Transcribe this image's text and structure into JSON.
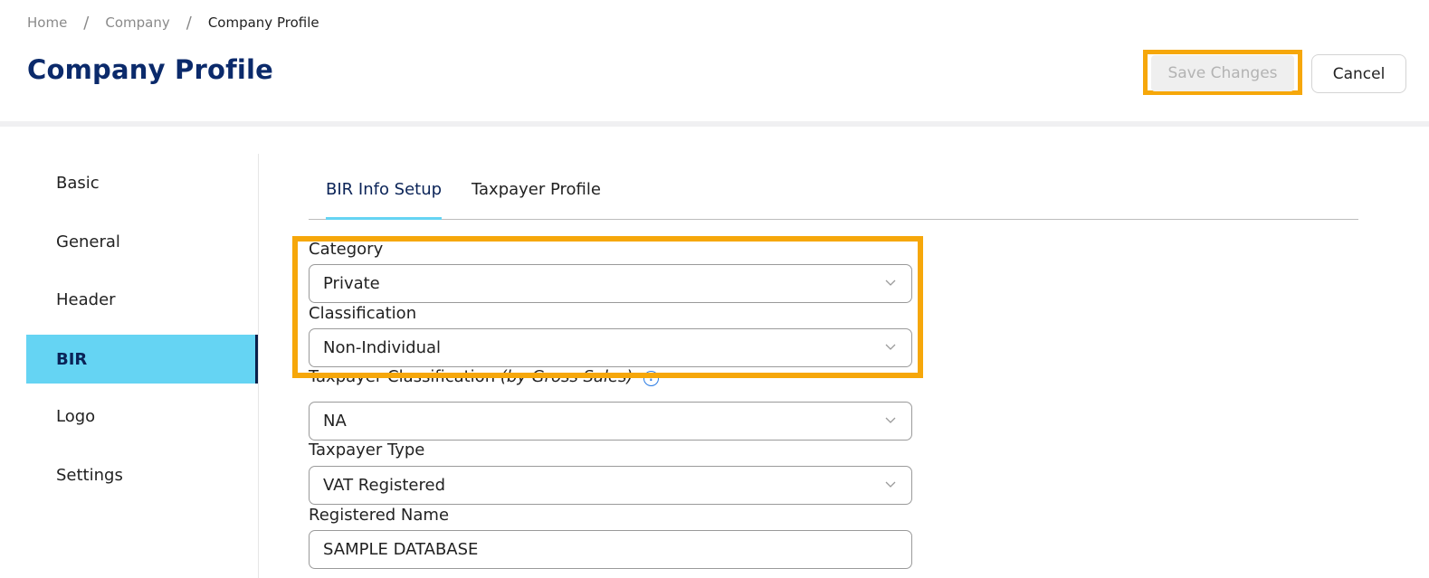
{
  "breadcrumb": {
    "items": [
      "Home",
      "Company",
      "Company Profile"
    ],
    "separator": "/"
  },
  "page": {
    "title": "Company Profile"
  },
  "actions": {
    "save_label": "Save Changes",
    "cancel_label": "Cancel"
  },
  "sidebar": {
    "items": [
      {
        "label": "Basic"
      },
      {
        "label": "General"
      },
      {
        "label": "Header"
      },
      {
        "label": "BIR"
      },
      {
        "label": "Logo"
      },
      {
        "label": "Settings"
      }
    ],
    "active": "BIR"
  },
  "tabs": [
    {
      "label": "BIR Info Setup"
    },
    {
      "label": "Taxpayer Profile"
    }
  ],
  "form": {
    "category": {
      "label": "Category",
      "value": "Private"
    },
    "classification": {
      "label": "Classification",
      "value": "Non-Individual"
    },
    "taxpayer_classification": {
      "label": "Taxpayer Classification",
      "label_italic": "(by Gross Sales)",
      "help_icon": "?",
      "value": "NA"
    },
    "taxpayer_type": {
      "label": "Taxpayer Type",
      "value": "VAT Registered"
    },
    "registered_name": {
      "label": "Registered Name",
      "value": "SAMPLE DATABASE"
    }
  },
  "colors": {
    "brand_navy": "#0b2a6b",
    "active_sidebar": "#65d4f3",
    "highlight": "#f6a70a",
    "help_blue": "#2a7be4"
  }
}
